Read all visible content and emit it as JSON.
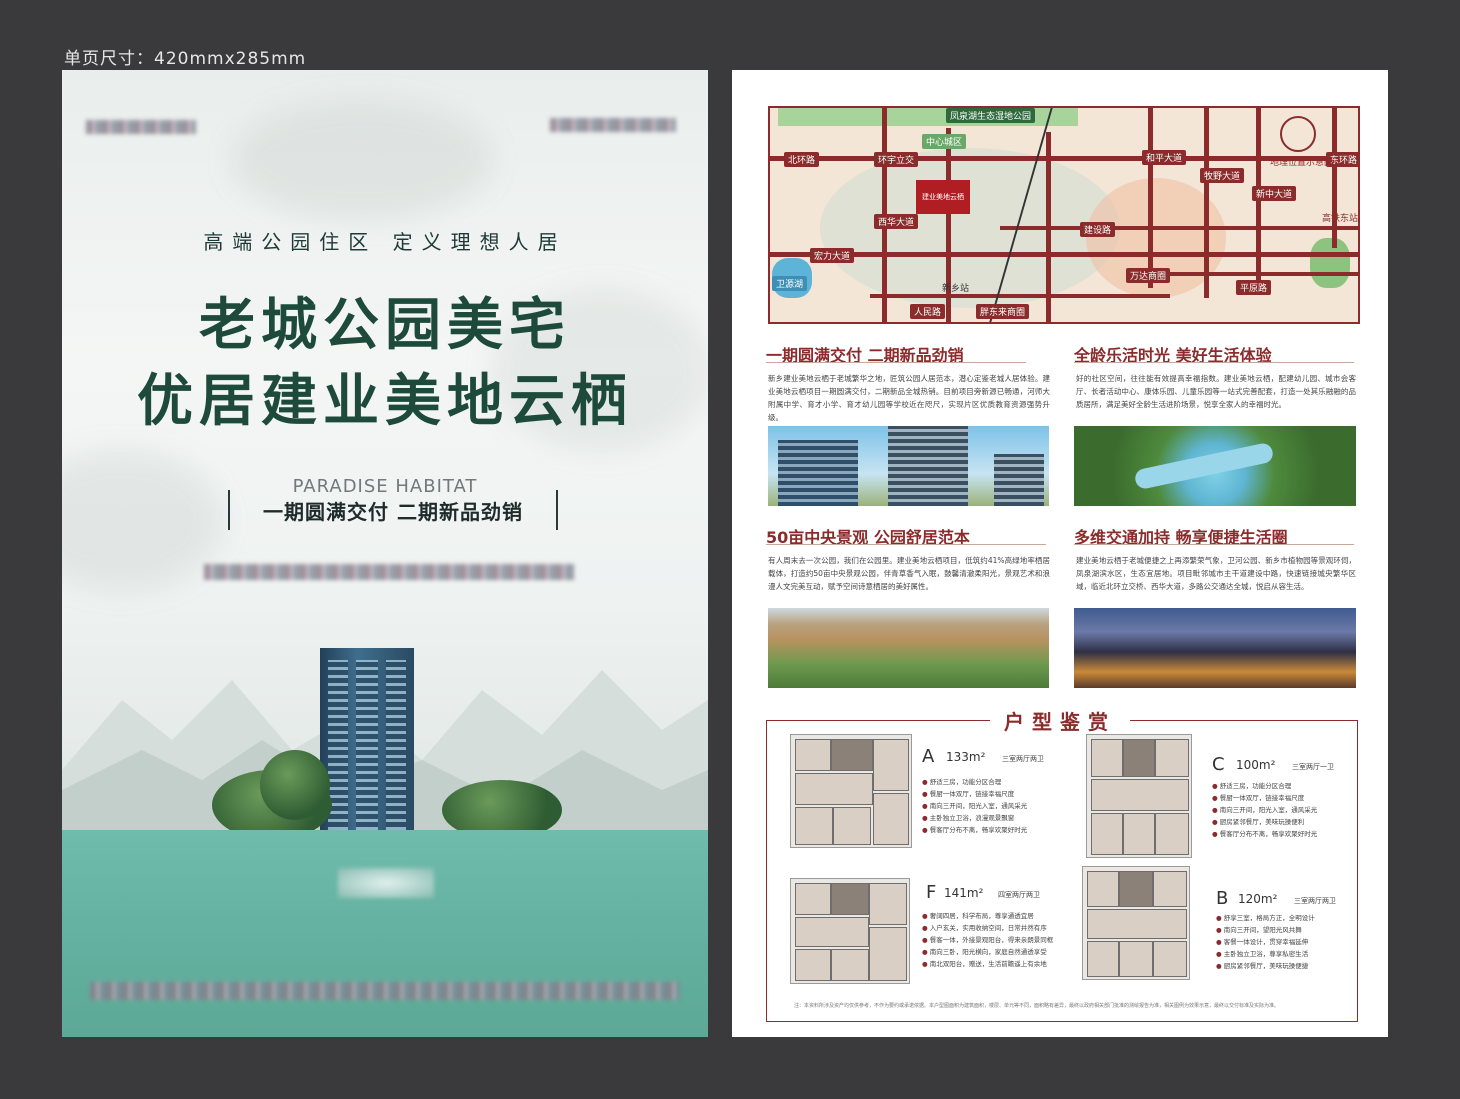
{
  "canvas_label": "单页尺寸：420mmx285mm",
  "left_page": {
    "slogan": "高端公园住区   定义理想人居",
    "title_line1": "老城公园美宅",
    "title_line2": "优居建业美地云栖",
    "english_name": "PARADISE HABITAT",
    "phase_text": "一期圆满交付 二期新品劲销"
  },
  "right_page": {
    "map": {
      "labels": {
        "park_top": "凤泉湖生态湿地公园",
        "center": "中心城区",
        "north_ring": "北环路",
        "huanyu": "环宇立交",
        "xihua": "西华大道",
        "hongli": "宏力大道",
        "weiyuan": "卫源湖",
        "xinxiang_station": "新乡站",
        "renmin": "人民路",
        "pangdonglai": "胖东来商圈",
        "jianshe": "建设路",
        "wanda": "万达商圈",
        "pingyuan": "平原路",
        "heping": "和平大道",
        "muye": "牧野大道",
        "xinzhong": "新中大道",
        "east_ring": "东环路",
        "hsr_east": "高铁东站",
        "legend": "地理位置示意图",
        "project_badge": "建业美地云栖"
      }
    },
    "sections": [
      {
        "title": "一期圆满交付 二期新品劲销",
        "text": "新乡建业美地云栖于老城繁华之地，匠筑公园人居范本，潜心定鉴老城人居体验。建业美地云栖项目一期圆满交付，二期新品全城热销。目前项目旁新源已畅通，河师大附属中学、育才小学、育才幼儿园等学校近在咫尺，实现片区优质教育资源强势升级。"
      },
      {
        "title": "全龄乐活时光 美好生活体验",
        "text": "好的社区空间，往往能有效提高幸福指数。建业美地云栖，配建幼儿园、城市会客厅、长者活动中心、康体乐园、儿童乐园等一站式完善配套，打造一处其乐融融的品质居所，满足美好全龄生活进阶场景，悦享全家人的幸福时光。"
      },
      {
        "title": "50亩中央景观 公园舒居范本",
        "text": "有人周末去一次公园，我们在公园里。建业美地云栖项目，低筑约41%高绿地率栖居载体，打造约50亩中央景观公园，伴青草香气入眠，鼓馨清澈柔阳光，景观艺术和浪漫人文完美互动，赋予空间诗意栖居的美好属性。"
      },
      {
        "title": "多维交通加持 畅享便捷生活圈",
        "text": "建业美地云栖于老城便捷之上再添繁荣气象，卫河公园、新乡市植物园等景观环伺，凤泉湖滨水区，生态宜居地。项目毗邻城市主干道建设中路，快速链接城央繁华区域，临近北环立交桥、西华大道，多路公交通达全城，悦启从容生活。"
      }
    ],
    "floor_section_title": "户型鉴赏",
    "plans": [
      {
        "type": "A",
        "sub": "1",
        "area": "133m²",
        "desc": "三室两厅两卫",
        "features": [
          "舒适三房，功能分区合理",
          "餐厨一体双厅，链接幸福尺度",
          "南向三开间，阳光入室，通风采光",
          "主卧独立卫浴，浪漫观景飘窗",
          "餐客厅分布不离，畅享欢聚好时光"
        ]
      },
      {
        "type": "C",
        "sub": "2",
        "area": "100m²",
        "desc": "三室两厅一卫",
        "features": [
          "舒适三房，功能分区合理",
          "餐厨一体双厅，链接幸福尺度",
          "南向三开间，阳光入室，通风采光",
          "厨房紧邻餐厅，美味玩操便利",
          "餐客厅分布不离，畅享欢聚好时光"
        ]
      },
      {
        "type": "F",
        "sub": "",
        "area": "141m²",
        "desc": "四室两厅两卫",
        "features": [
          "奢阔四居，科学布局，尊享通透宜居",
          "入户玄关，实用收纳空间，日常井然有序",
          "餐客一体，外接景观阳台，得来亲朗景同框",
          "南向三卧，阳光横向，家庭自然通透享受",
          "南北双阳台，赠送，生活前瞻遥上有余地"
        ]
      },
      {
        "type": "B",
        "sub": "2",
        "area": "120m²",
        "desc": "三室两厅两卫",
        "features": [
          "舒享三室，格局方正，全明设计",
          "南向三开间，望阳光风共舞",
          "客餐一体设计，贯穿幸福延伸",
          "主卧独立卫浴，尊享私密生活",
          "厨房紧邻餐厅，美味玩操便捷"
        ]
      }
    ],
    "footnote": "注：本资料所涉及资产均仅供参考，不作为要约或承诺依据。本户型图面积为建筑面积，楼层、单元等不同，面积略有差异，最终以政府相关部门批准的测绘报告为准，相关图例为效果示意，最终以交付标准及实际为准。"
  },
  "colors": {
    "accent": "#8b2b2b",
    "title_green": "#1d4a3a",
    "water": "#66b3a3"
  }
}
